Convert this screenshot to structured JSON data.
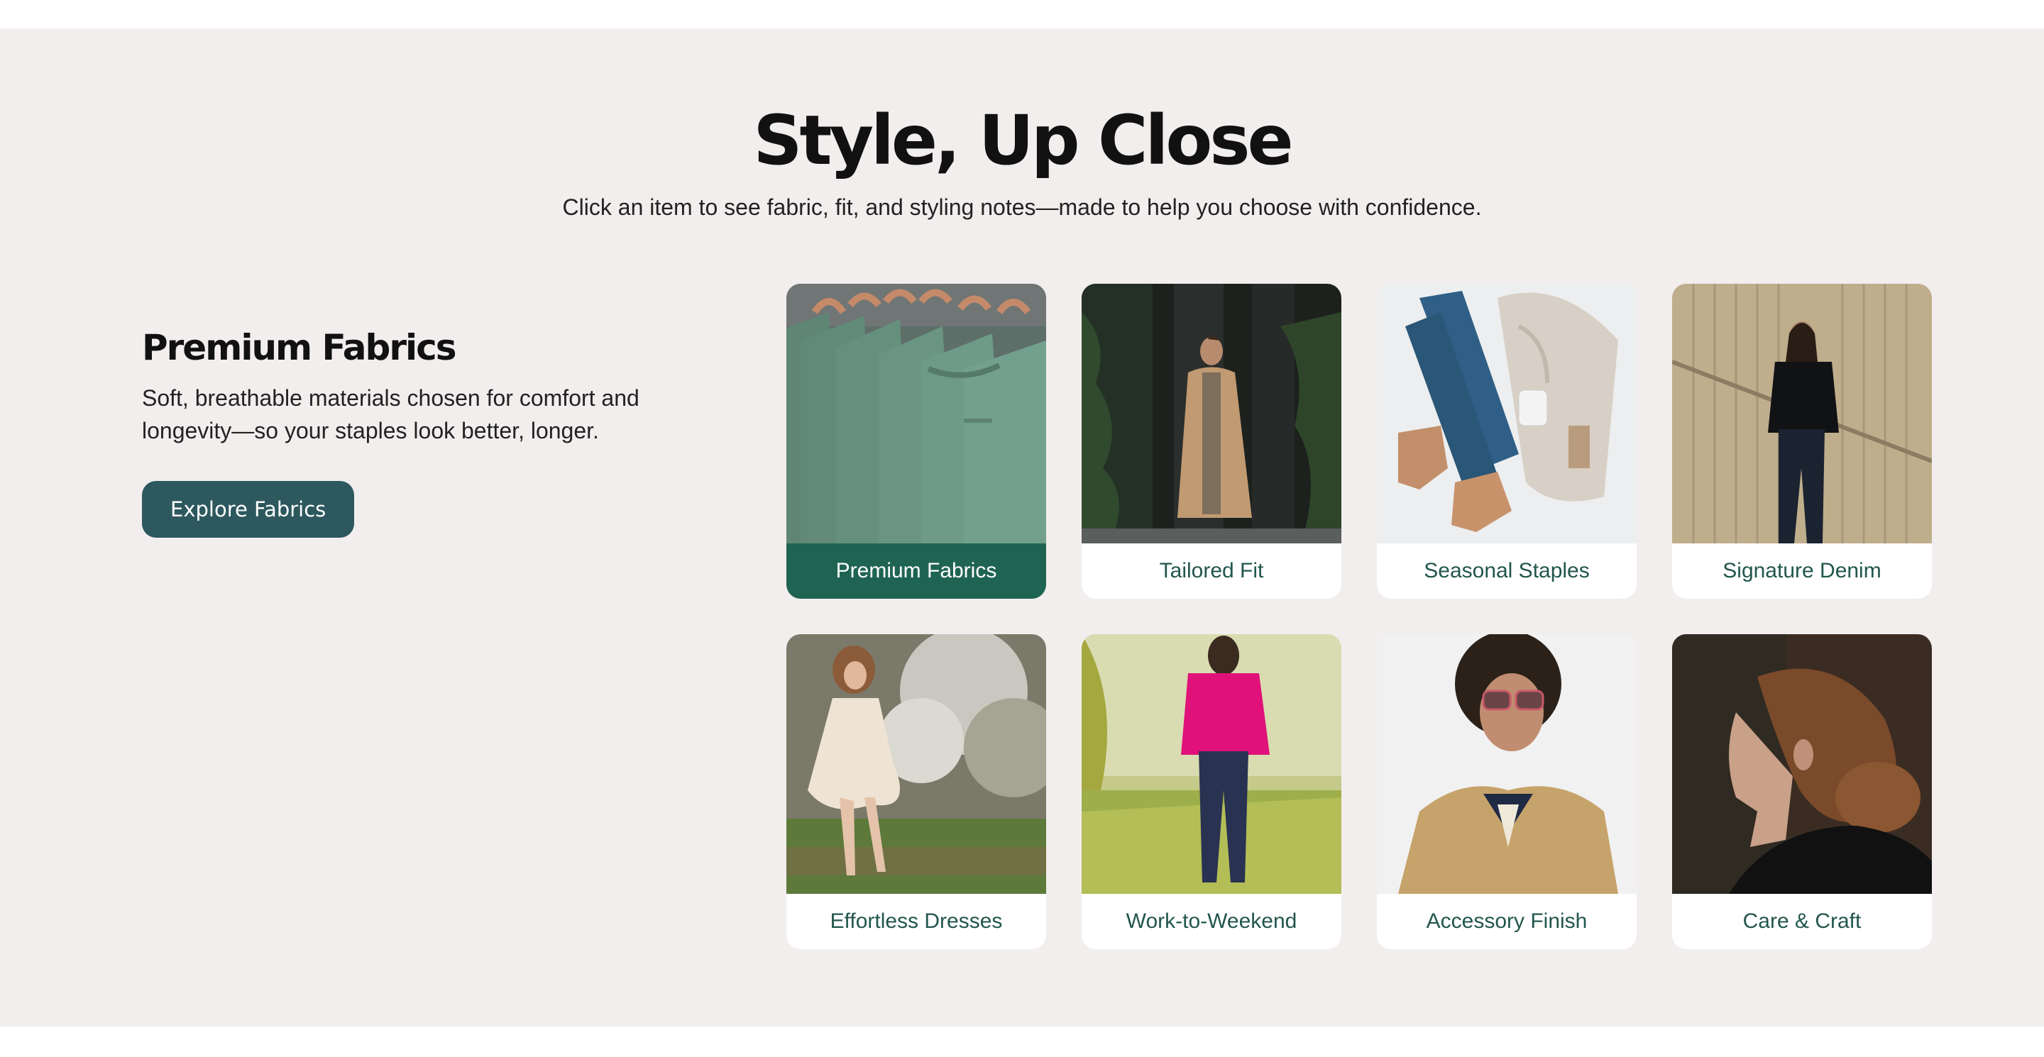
{
  "header": {
    "title": "Style, Up Close",
    "subtitle": "Click an item to see fabric, fit, and styling notes—made to help you choose with confidence."
  },
  "detail": {
    "title": "Premium Fabrics",
    "text": "Soft, breathable materials chosen for comfort and longevity—so your staples look better, longer.",
    "button_label": "Explore Fabrics"
  },
  "cards": [
    {
      "label": "Premium Fabrics",
      "image": "green-tshirts-on-hangers",
      "active": true
    },
    {
      "label": "Tailored Fit",
      "image": "woman-in-camel-coat"
    },
    {
      "label": "Seasonal Staples",
      "image": "jeans-sweater-boots-flatlay"
    },
    {
      "label": "Signature Denim",
      "image": "woman-black-outfit-wood-wall"
    },
    {
      "label": "Effortless Dresses",
      "image": "woman-in-white-dress-blossoms"
    },
    {
      "label": "Work-to-Weekend",
      "image": "woman-pink-shirt-in-field"
    },
    {
      "label": "Accessory Finish",
      "image": "woman-with-sunglasses-trench"
    },
    {
      "label": "Care & Craft",
      "image": "woman-hair-bun-profile"
    }
  ],
  "colors": {
    "section_bg": "#f1eeed",
    "button_bg": "#2d585e",
    "active_label_bg": "#1f6452",
    "label_text": "#22564d"
  }
}
